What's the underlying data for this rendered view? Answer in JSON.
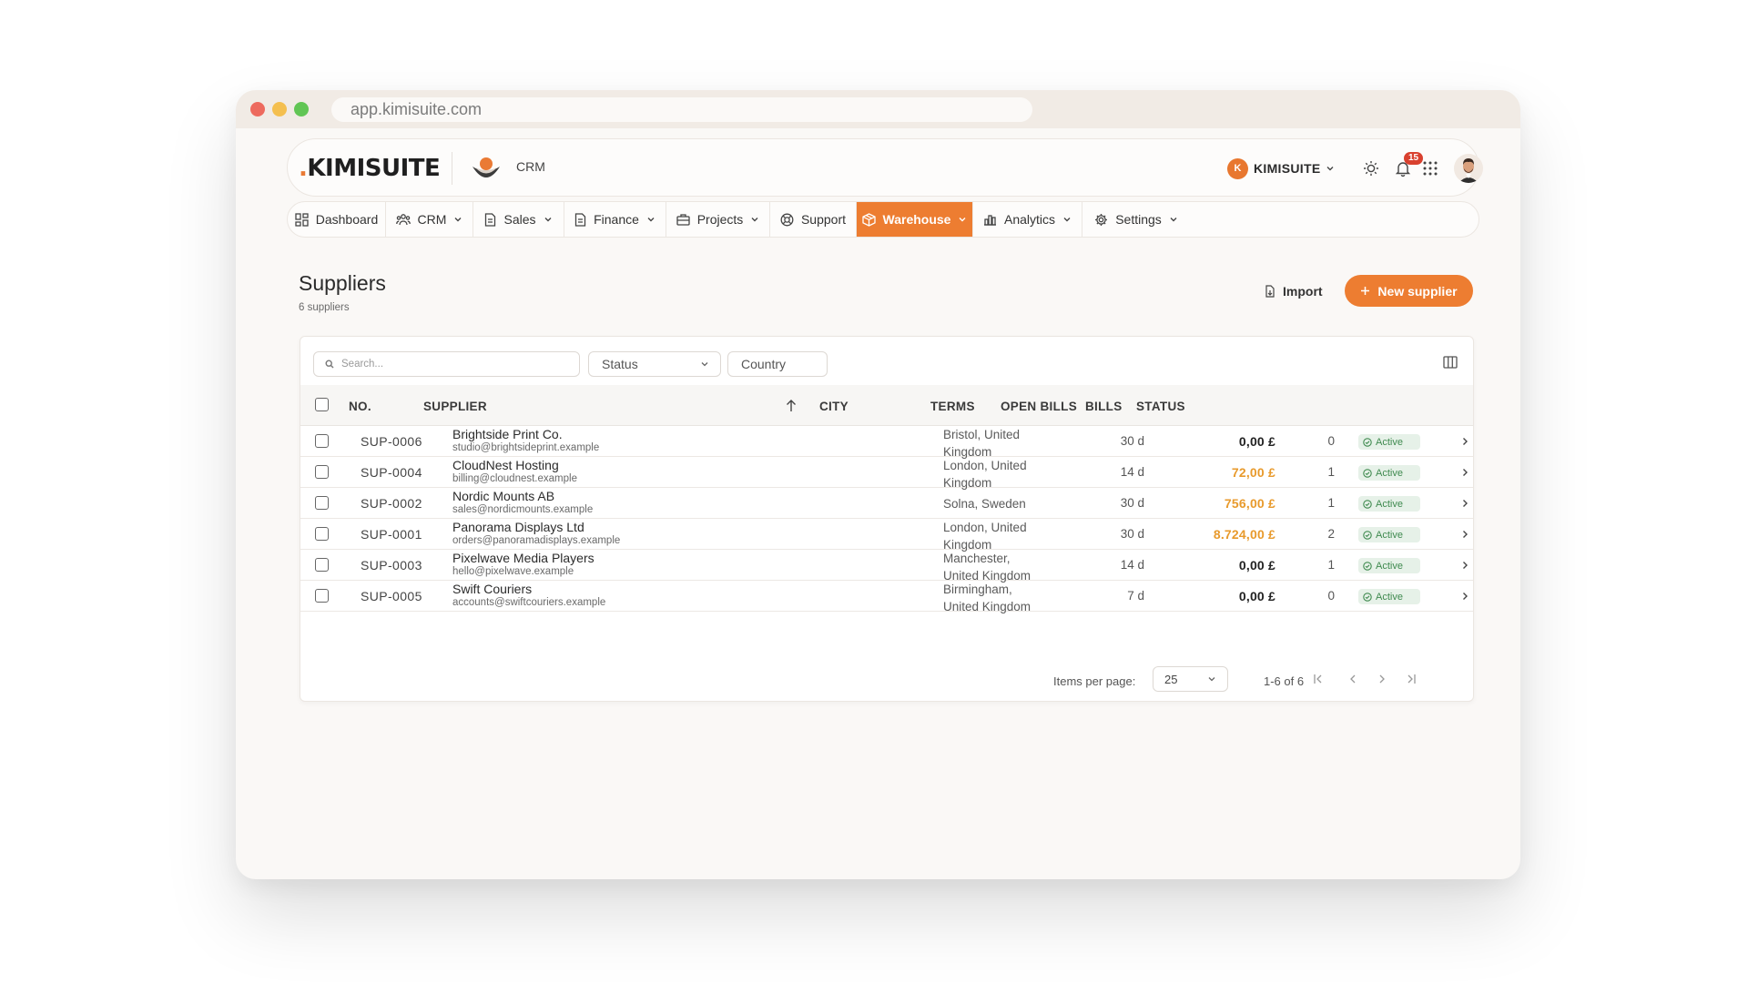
{
  "browser": {
    "url": "app.kimisuite.com"
  },
  "header": {
    "logo_prefix": ".",
    "logo_text": "KIMISUITE",
    "module_label": "CRM",
    "org_initial": "K",
    "org_name": "KIMISUITE",
    "notification_count": "15"
  },
  "nav": {
    "items": [
      {
        "label": "Dashboard",
        "icon": "dashboard-icon"
      },
      {
        "label": "CRM",
        "icon": "users-icon"
      },
      {
        "label": "Sales",
        "icon": "document-icon"
      },
      {
        "label": "Finance",
        "icon": "document-icon"
      },
      {
        "label": "Projects",
        "icon": "briefcase-icon"
      },
      {
        "label": "Support",
        "icon": "lifebuoy-icon"
      },
      {
        "label": "Warehouse",
        "icon": "box-icon",
        "active": true
      },
      {
        "label": "Analytics",
        "icon": "bar-chart-icon"
      },
      {
        "label": "Settings",
        "icon": "gear-icon"
      }
    ]
  },
  "page": {
    "title": "Suppliers",
    "subtitle": "6 suppliers",
    "import_label": "Import",
    "new_label": "New supplier"
  },
  "filters": {
    "search_placeholder": "Search...",
    "status_label": "Status",
    "country_label": "Country"
  },
  "table": {
    "columns": [
      "NO.",
      "SUPPLIER",
      "CITY",
      "TERMS",
      "OPEN BILLS",
      "BILLS",
      "STATUS"
    ],
    "rows": [
      {
        "no": "SUP-0006",
        "name": "Brightside Print Co.",
        "email": "studio@brightsideprint.example",
        "city_line1": "Bristol, United",
        "city_line2": "Kingdom",
        "terms": "30 d",
        "open_bills": "0,00 £",
        "open_due": false,
        "bills": "0",
        "status": "Active"
      },
      {
        "no": "SUP-0004",
        "name": "CloudNest Hosting",
        "email": "billing@cloudnest.example",
        "city_line1": "London, United",
        "city_line2": "Kingdom",
        "terms": "14 d",
        "open_bills": "72,00 £",
        "open_due": true,
        "bills": "1",
        "status": "Active"
      },
      {
        "no": "SUP-0002",
        "name": "Nordic Mounts AB",
        "email": "sales@nordicmounts.example",
        "city_line1": "Solna, Sweden",
        "city_line2": "",
        "terms": "30 d",
        "open_bills": "756,00 £",
        "open_due": true,
        "bills": "1",
        "status": "Active"
      },
      {
        "no": "SUP-0001",
        "name": "Panorama Displays Ltd",
        "email": "orders@panoramadisplays.example",
        "city_line1": "London, United",
        "city_line2": "Kingdom",
        "terms": "30 d",
        "open_bills": "8.724,00 £",
        "open_due": true,
        "bills": "2",
        "status": "Active"
      },
      {
        "no": "SUP-0003",
        "name": "Pixelwave Media Players",
        "email": "hello@pixelwave.example",
        "city_line1": "Manchester,",
        "city_line2": "United Kingdom",
        "terms": "14 d",
        "open_bills": "0,00 £",
        "open_due": false,
        "bills": "1",
        "status": "Active"
      },
      {
        "no": "SUP-0005",
        "name": "Swift Couriers",
        "email": "accounts@swiftcouriers.example",
        "city_line1": "Birmingham,",
        "city_line2": "United Kingdom",
        "terms": "7 d",
        "open_bills": "0,00 £",
        "open_due": false,
        "bills": "0",
        "status": "Active"
      }
    ]
  },
  "pagination": {
    "items_per_page_label": "Items per page:",
    "items_per_page_value": "25",
    "range": "1-6 of 6"
  },
  "colors": {
    "accent": "#ed7d31",
    "active_badge_bg": "#e6f1e8",
    "active_badge_text": "#3f8a4f",
    "due_amount": "#e89a2c"
  }
}
